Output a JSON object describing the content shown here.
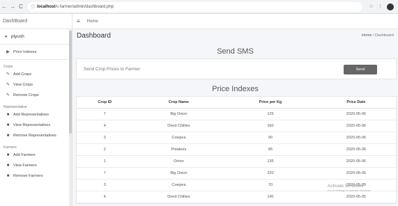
{
  "browser": {
    "back": "←",
    "forward": "→",
    "reload": "C",
    "info": "ⓘ",
    "url_host": "localhost",
    "url_path": "/c-farmer/admin/dashboard.php",
    "star": "☆",
    "menu": "⋮"
  },
  "sidebar": {
    "brand": "DashBoard",
    "user": "piyush",
    "top_link": "Price Indexes",
    "sections": [
      {
        "heading": "Crops",
        "items": [
          "Add Crops",
          "View Crops",
          "Remove Crops"
        ]
      },
      {
        "heading": "Representative",
        "items": [
          "Add Representatives",
          "View Representatives",
          "Remove Representatives"
        ]
      },
      {
        "heading": "Farmers",
        "items": [
          "Add Farmers",
          "View Farmers",
          "Remove Farmers"
        ]
      }
    ]
  },
  "topnav": {
    "menu_icon": "≡",
    "home": "Home"
  },
  "header": {
    "title": "Dashboard",
    "breadcrumb_home": "Home",
    "breadcrumb_sep": " / ",
    "breadcrumb_current": "Dashboard"
  },
  "sms": {
    "title": "Send SMS",
    "prompt": "Send Crop Prices to Farmer",
    "button": "Send"
  },
  "prices": {
    "title": "Price Indexes",
    "columns": [
      "Crop ID",
      "Crop Name",
      "Price per Kg",
      "Price Date"
    ],
    "rows": [
      [
        "7",
        "Big Onion",
        "125",
        "2020-05-06"
      ],
      [
        "4",
        "Dried Chillies",
        "160",
        "2020-05-06"
      ],
      [
        "3",
        "Cowpea",
        "90",
        "2020-05-06"
      ],
      [
        "2",
        "Potatoes",
        "85",
        "2020-05-06"
      ],
      [
        "1",
        "Onion",
        "135",
        "2020-05-06"
      ],
      [
        "7",
        "Big Onion",
        "220",
        "2020-05-05"
      ],
      [
        "3",
        "Cowpea",
        "70",
        "2020-05-05"
      ],
      [
        "4",
        "Dried Chillies",
        "140",
        "2020-05-05"
      ]
    ]
  },
  "watermark": {
    "line1": "Activate Windows",
    "line2": "Go to Settings to activate Windows."
  }
}
